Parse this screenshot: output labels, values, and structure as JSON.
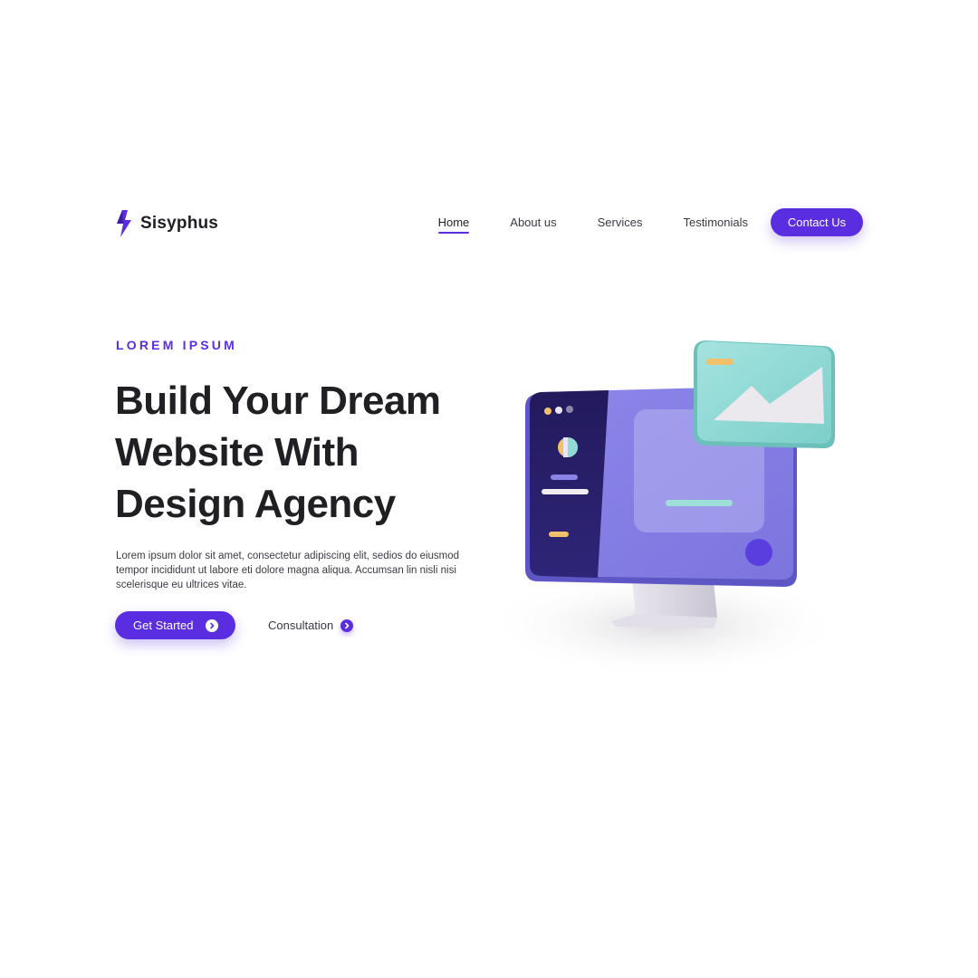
{
  "brand": {
    "name": "Sisyphus",
    "logo_icon": "lightning-bolt-icon"
  },
  "nav": {
    "items": [
      {
        "label": "Home",
        "active": true
      },
      {
        "label": "About us",
        "active": false
      },
      {
        "label": "Services",
        "active": false
      },
      {
        "label": "Testimonials",
        "active": false
      }
    ],
    "contact_label": "Contact Us"
  },
  "hero": {
    "eyebrow": "LOREM IPSUM",
    "headline_lines": [
      "Build Your Dream",
      "Website With",
      "Design Agency"
    ],
    "body_lines": [
      "Lorem ipsum dolor sit amet, consectetur adipiscing elit, sedios do eiusmod",
      "tempor incididunt ut labore eti dolore magna aliqua. Accumsan lin nisli nisi",
      "scelerisque eu ultrices vitae."
    ],
    "primary_cta": {
      "label": "Get Started",
      "icon": "chevron-right-icon"
    },
    "secondary_cta": {
      "label": "Consultation",
      "icon": "chevron-right-icon"
    }
  },
  "illustration": {
    "name": "3d-monitor-illustration"
  },
  "colors": {
    "accent": "#5a2ee0",
    "text_dark": "#1f1f24",
    "monitor_dark": "#2b2170",
    "monitor_light": "#8a84e6",
    "teal": "#8fd9d6",
    "yellow": "#f0c06a"
  }
}
